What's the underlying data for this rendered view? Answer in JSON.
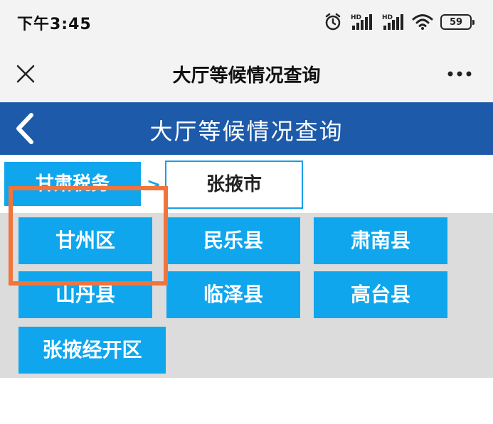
{
  "status": {
    "time": "下午3:45",
    "battery": "59",
    "signal_label_1": "HD",
    "signal_label_2": "HD"
  },
  "titlebar": {
    "title": "大厅等候情况查询"
  },
  "header": {
    "title": "大厅等候情况查询"
  },
  "breadcrumb": {
    "first": "甘肃税务",
    "separator": ">",
    "current": "张掖市"
  },
  "districts": [
    {
      "label": "甘州区"
    },
    {
      "label": "民乐县"
    },
    {
      "label": "肃南县"
    },
    {
      "label": "山丹县"
    },
    {
      "label": "临泽县"
    },
    {
      "label": "高台县"
    },
    {
      "label": "张掖经开区"
    }
  ],
  "colors": {
    "header_blue": "#1d5aa9",
    "button_blue": "#0fa6ee",
    "highlight_orange": "#f0743c"
  }
}
